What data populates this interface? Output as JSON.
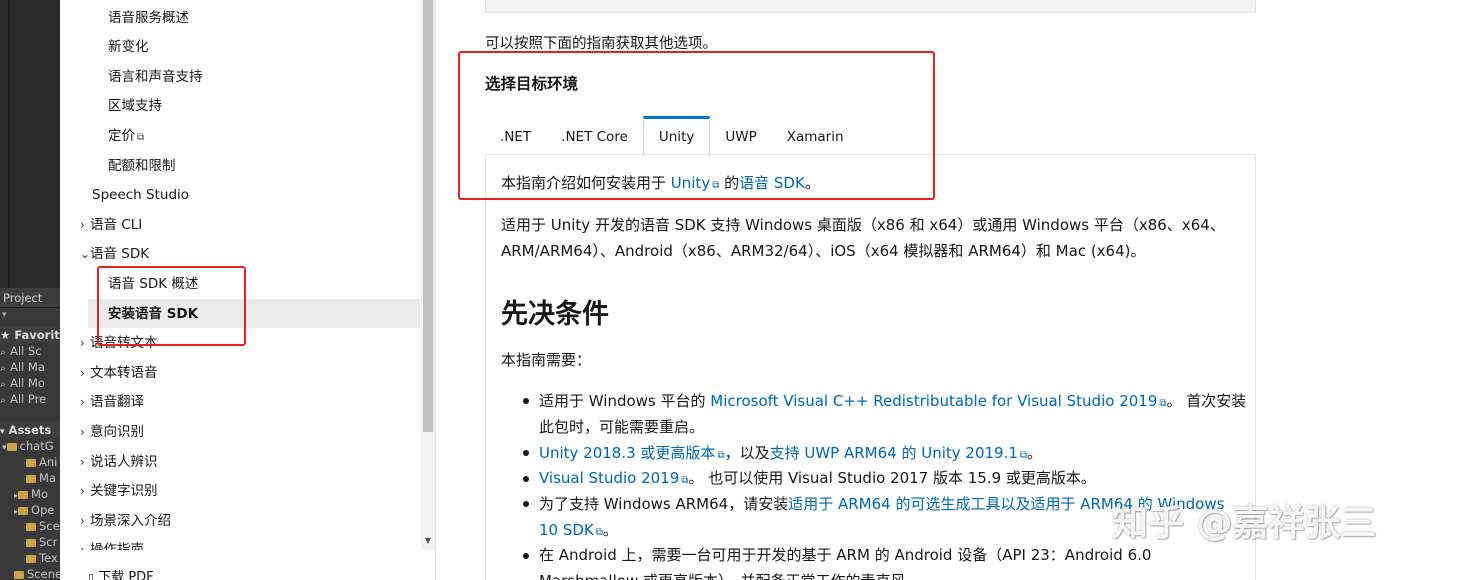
{
  "unity": {
    "project_tab": "Project",
    "favorites_label": "★ Favorites",
    "favorites": [
      "All Sc",
      "All Ma",
      "All Mo",
      "All Pre"
    ],
    "assets_label": "Assets",
    "folders": [
      "chatG",
      "Ani",
      "Ma",
      "Mo",
      "Ope",
      "Sce",
      "Scr",
      "Tex",
      "Scene"
    ]
  },
  "nav": {
    "items": {
      "svc": "语音服务概述",
      "new": "新变化",
      "lang": "语言和声音支持",
      "region": "区域支持",
      "pricing": "定价",
      "quota": "配额和限制",
      "studio": "Speech Studio",
      "cli": "语音 CLI",
      "sdk": "语音 SDK",
      "sdk_overview": "语音 SDK 概述",
      "install_sdk": "安装语音 SDK",
      "stt": "语音转文本",
      "tts": "文本转语音",
      "translate": "语音翻译",
      "intent": "意向识别",
      "speaker": "说话人辨识",
      "keyword": "关键字识别",
      "scenarios": "场景深入介绍",
      "howto": "操作指南"
    },
    "download_pdf": "下载 PDF"
  },
  "content": {
    "intro": "可以按照下面的指南获取其他选项。",
    "env_heading": "选择目标环境",
    "tabs": [
      ".NET",
      ".NET Core",
      "Unity",
      "UWP",
      "Xamarin"
    ],
    "active_tab": "Unity",
    "line1_pre": "本指南介绍如何安装用于 ",
    "line1_link1": "Unity",
    "line1_mid": " 的",
    "line1_link2": "语音 SDK",
    "line1_post": "。",
    "support_1": "适用于 Unity 开发的语音 SDK 支持 Windows 桌面版（x86 和 x64）或通用 Windows 平台（x86、x64、",
    "support_2": "ARM/ARM64）、Android（x86、ARM32/64）、iOS（x64 模拟器和 ARM64）和 Mac (x64)。",
    "prereq_heading": "先决条件",
    "prereq_intro": "本指南需要：",
    "b1_pre": "适用于 Windows 平台的 ",
    "b1_link": "Microsoft Visual C++ Redistributable for Visual Studio 2019",
    "b1_post": "。 首次安装",
    "b1_line2": "此包时，可能需要重启。",
    "b2_link1": "Unity 2018.3 或更高版本",
    "b2_mid": "，以及",
    "b2_link2": "支持 UWP ARM64 的 Unity 2019.1",
    "b2_post": "。",
    "b3_link": "Visual Studio 2019",
    "b3_post": "。 也可以使用 Visual Studio 2017 版本 15.9 或更高版本。",
    "b4_pre": "为了支持 Windows ARM64，请安装",
    "b4_link": "适用于 ARM64 的可选生成工具以及适用于 ARM64 的 Windows",
    "b4_line2_link": "10 SDK",
    "b4_line2_post": "。",
    "b5_line1": "在 Android 上，需要一台可用于开发的基于 ARM 的 Android 设备（API 23：Android 6.0",
    "b5_line2": "Marshmallow 或更高版本），并配备正常工作的麦克风。"
  },
  "watermark": "知乎 @嘉祥张三",
  "colors": {
    "link": "#0065b3",
    "tab_accent": "#0078d4",
    "annotation": "#e02424"
  }
}
